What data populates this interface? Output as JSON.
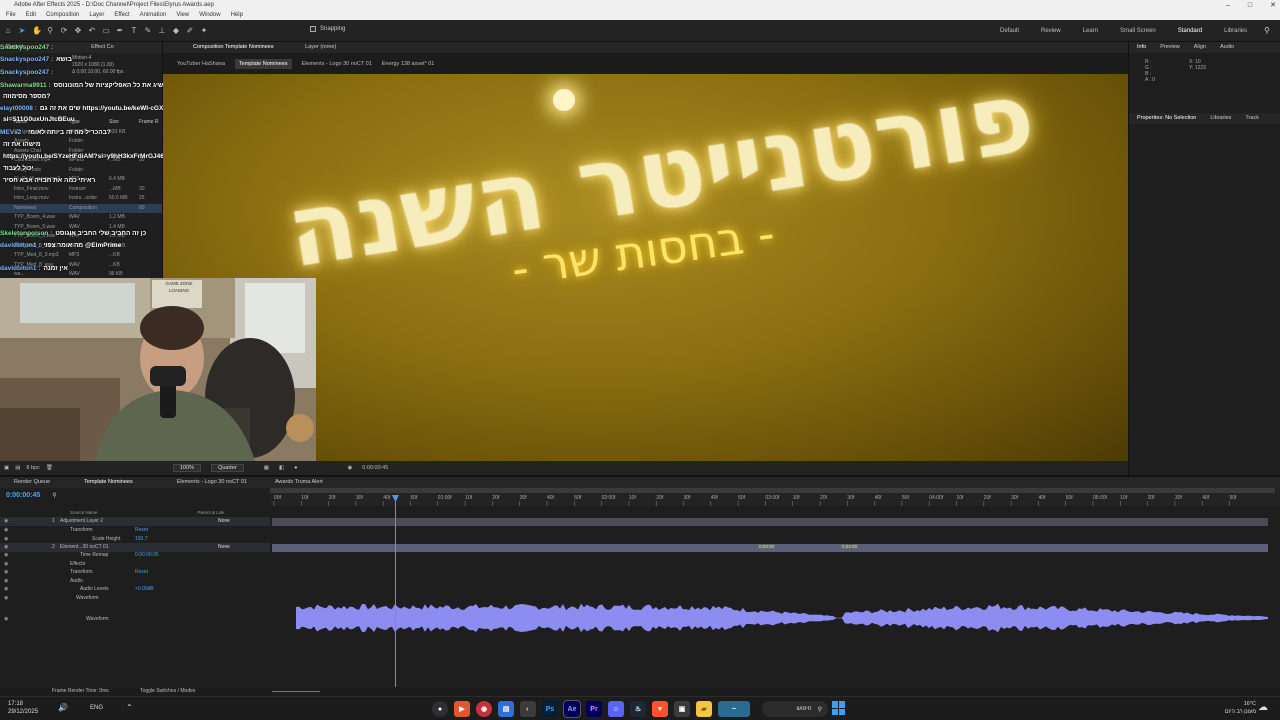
{
  "titlebar": {
    "title": "Adobe After Effects 2025 - D:\\Doc Channel\\Project Files\\Elyrus Awards.aep",
    "win_min": "–",
    "win_max": "□",
    "win_close": "✕"
  },
  "menu": [
    "File",
    "Edit",
    "Composition",
    "Layer",
    "Effect",
    "Animation",
    "View",
    "Window",
    "Help"
  ],
  "toolbar": {
    "snapping": "Snapping",
    "workspaces": [
      "Default",
      "Review",
      "Learn",
      "Small Screen",
      "Standard",
      "Libraries"
    ],
    "active_workspace": "Standard"
  },
  "project_panel": {
    "tabs": [
      "Project",
      "Effect Co"
    ],
    "selected_item": "Motion-4",
    "selected_meta1": "1920 x 1080 (1.00)",
    "selected_meta2": "Δ 0;00;10;00, 60.00 fps",
    "columns": [
      "Name",
      "Type",
      "Size",
      "Frame R"
    ],
    "files": [
      {
        "name": "3D Logo_dim.png",
        "type": "PNG file",
        "size": "333 KB",
        "fr": ""
      },
      {
        "name": "Assets",
        "type": "Folder",
        "size": "",
        "fr": ""
      },
      {
        "name": "Assets Chat",
        "type": "Folder",
        "size": "",
        "fr": ""
      },
      {
        "name": "Countdown.mp4",
        "type": "MPEG",
        "size": "...MB",
        "fr": "30"
      },
      {
        "name": "Crazy Posts",
        "type": "Folder",
        "size": "",
        "fr": ""
      },
      {
        "name": "Et_On M_ayum.mp3",
        "type": "MP3",
        "size": "6.4 MB",
        "fr": ""
      },
      {
        "name": "Intro_Final.mov",
        "type": "Instrum",
        "size": "...MB",
        "fr": "30"
      },
      {
        "name": "Intro_Loop.mov",
        "type": "Instrs...order",
        "size": "50.6 MB",
        "fr": "25"
      },
      {
        "name": "Nominees",
        "type": "Composition",
        "size": "",
        "fr": "60"
      },
      {
        "name": "TYP_Boom_4.wav",
        "type": "WAV",
        "size": "1.2 MB",
        "fr": ""
      },
      {
        "name": "TYP_Boom_5.wav",
        "type": "WAV",
        "size": "1.4 MB",
        "fr": ""
      },
      {
        "name": "TYP_Boom_6.wav",
        "type": "WAV",
        "size": "1.2 MB",
        "fr": ""
      },
      {
        "name": "TYP_Med_8_2.mp3",
        "type": "MP3",
        "size": "101 KB",
        "fr": ""
      },
      {
        "name": "TYP_Med_8_3.mp3",
        "type": "MP3",
        "size": "...KB",
        "fr": ""
      },
      {
        "name": "TYP_Med_8_wav",
        "type": "WAV",
        "size": "...KB",
        "fr": ""
      },
      {
        "name": "wa...",
        "type": "WAV",
        "size": "96 KB",
        "fr": ""
      }
    ],
    "bpc": "8 bpc"
  },
  "chat": [
    {
      "user": "Snackyspoo247 :",
      "msg": ""
    },
    {
      "user": "Snackyspoo247 :",
      "msg": "בושא"
    },
    {
      "user": "Snackyspoo247 :",
      "msg": ""
    },
    {
      "user": "Shawarma9911 :",
      "msg": "שו תאמינה אחת חשיג את כל האפליקציות של המונונוסס"
    },
    {
      "user": "",
      "msg": "מספר מסימוזה?"
    },
    {
      "user": "elayt00008 :",
      "msg": "שים את זה גם https://youtu.be/keWI-cGXrl0?"
    },
    {
      "user": "",
      "msg": "si=S11G0uxUnJtcBEuu"
    },
    {
      "user": "MEVs2 :",
      "msg": "בהכריל מה זה ביותה לאומי?"
    },
    {
      "user": "",
      "msg": "מישהו את זה"
    },
    {
      "user": "",
      "msg": "https://youtu.be/SYzeHFdiAM?si=y9hH3kxFrMrGJ46N"
    },
    {
      "user": "",
      "msg": "יכול לעבוד"
    },
    {
      "user": "",
      "msg": "ראיתי כמה את חבויה אבא חסיר"
    },
    {
      "user": "Skeletonpoison :",
      "msg": "כן זה החביב שלי החביב אוגוסט"
    },
    {
      "user": "davidbiton1 :",
      "msg": "מה אומר צפוי @ElmPrime"
    },
    {
      "user": "davidbiton1 :",
      "msg": "אין זמנה"
    }
  ],
  "composition": {
    "panel_title": "Composition Template Nominees",
    "layer_tab": "Layer (none)",
    "tabs": [
      "YouTuber HaShana",
      "Template Nominees",
      "Elements - Logo 30 noCT 01",
      "Energy 138 asset* 01"
    ],
    "active_tab": "Template Nominees",
    "text_line1": "פורטנייטר השנה",
    "text_line2": "- בחסות שר -",
    "zoom": "100%",
    "resolution": "Quarter",
    "timecode": "0:00:00:45"
  },
  "webcam": {
    "sign_line1": "GAME ZONE",
    "sign_line2": "LOADING"
  },
  "right_panel": {
    "tabs": [
      "Info",
      "Preview",
      "Align",
      "Audio"
    ],
    "info_rows": [
      "R :",
      "G :",
      "B :",
      "A : 0"
    ],
    "xy": [
      "X: 10",
      "Y: 1223"
    ],
    "tabs2": [
      "Properties: No Selection",
      "Libraries",
      "Track"
    ]
  },
  "timeline": {
    "tabs": [
      "Render Queue",
      "Template Nominees",
      "Elements - Logo 30 noCT 01",
      "Awards Truma Alert"
    ],
    "active_tab": "Template Nominees",
    "timecode": "0:00:00:45",
    "columns": [
      "Source Name",
      "Parent & Link"
    ],
    "ruler": [
      "00f",
      "10f",
      "20f",
      "30f",
      "40f",
      "50f",
      "01:00f",
      "10f",
      "20f",
      "30f",
      "40f",
      "50f",
      "02:00f",
      "10f",
      "20f",
      "30f",
      "40f",
      "50f",
      "03:00f",
      "10f",
      "20f",
      "30f",
      "40f",
      "50f",
      "04:00f",
      "10f",
      "20f",
      "30f",
      "40f",
      "50f",
      "05:00f",
      "10f",
      "20f",
      "30f",
      "40f",
      "50f"
    ],
    "rows": [
      {
        "idx": "1",
        "name": "Adjustment Layer 2",
        "parent": "None"
      },
      {
        "idx": "",
        "name": "Transform",
        "parent": "Reset"
      },
      {
        "idx": "",
        "name": "Scale Height",
        "parent": "100.7"
      },
      {
        "idx": "2",
        "name": "Element...30 noCT 01",
        "parent": "None"
      },
      {
        "idx": "",
        "name": "Time Remap",
        "parent": "0:00:00:05"
      },
      {
        "idx": "",
        "name": "Effects",
        "parent": ""
      },
      {
        "idx": "",
        "name": "Transform",
        "parent": "Reset"
      },
      {
        "idx": "",
        "name": "Audio",
        "parent": ""
      },
      {
        "idx": "",
        "name": "Audio Levels",
        "parent": "+0.00dB"
      },
      {
        "idx": "",
        "name": "Waveform",
        "parent": ""
      },
      {
        "idx": "",
        "name": "Waveform",
        "parent": ""
      }
    ],
    "render_time": "Frame Render Time: 0ms",
    "toggle": "Toggle Switches / Modes",
    "kf_a": "0;03:00",
    "kf_b": "0;04:00",
    "accent": "#4a9cf5"
  },
  "taskbar": {
    "time": "17:18",
    "date": "29/12/2025",
    "lang": "ENG",
    "search": "חיפוש",
    "weather_temp": "16°C",
    "weather_text": "מעונן רב היום"
  }
}
